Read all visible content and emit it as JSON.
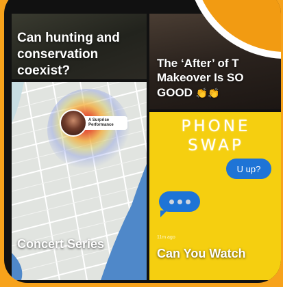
{
  "tiles": [
    {
      "headline_lines": [
        "Can hunting and",
        "conservation",
        "coexist?"
      ]
    },
    {
      "headline_lines": [
        "The ‘After’ of T",
        "Makeover Is SO",
        "GOOD"
      ],
      "emoji": "👏👏"
    },
    {
      "map_pin_label": "A Surprise Performance",
      "headline": "Concert Series"
    },
    {
      "banner_lines": [
        "PHONE",
        "SWAP"
      ],
      "message_text": "U up?",
      "time_ago": "11m ago",
      "headline": "Can You Watch"
    }
  ],
  "colors": {
    "background": "#f7a21b",
    "snap_yellow": "#f5cf10",
    "message_blue": "#1e74d6"
  }
}
